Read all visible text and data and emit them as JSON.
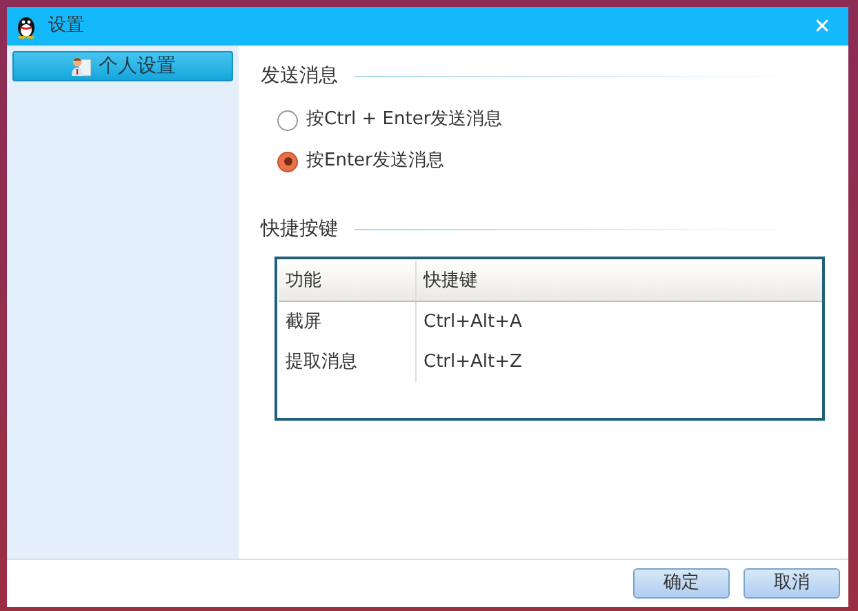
{
  "window": {
    "title": "设置",
    "close": "✕"
  },
  "sidebar": {
    "items": [
      {
        "label": "个人设置",
        "selected": true
      }
    ]
  },
  "send_message": {
    "title": "发送消息",
    "options": [
      {
        "label": "按Ctrl + Enter发送消息",
        "selected": false
      },
      {
        "label": "按Enter发送消息",
        "selected": true
      }
    ]
  },
  "shortcuts": {
    "title": "快捷按键",
    "table": {
      "columns": [
        "功能",
        "快捷键"
      ],
      "rows": [
        [
          "截屏",
          "Ctrl+Alt+A"
        ],
        [
          "提取消息",
          "Ctrl+Alt+Z"
        ]
      ]
    }
  },
  "buttons": [
    "确定",
    "取消"
  ]
}
